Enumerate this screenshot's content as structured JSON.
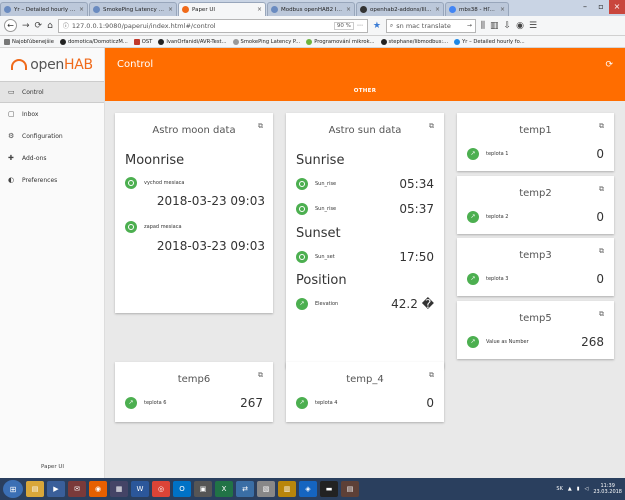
{
  "browser": {
    "tabs": [
      {
        "label": "Yr – Detailed hourly fo...",
        "active": false
      },
      {
        "label": "SmokePing Latency P...",
        "active": false
      },
      {
        "label": "Paper UI",
        "active": true
      },
      {
        "label": "Modbus openHAB2 In...",
        "active": false
      },
      {
        "label": "openhab2-addons/Ill...",
        "active": false
      },
      {
        "label": "mbs38 - Hľadať Googl...",
        "active": false
      }
    ],
    "url": "127.0.0.1:9080/paperui/index.html#/control",
    "zoom": "90 %",
    "search_placeholder": "sn mac translate",
    "bookmarks": [
      "Najobľúbenejšie",
      "domotica/DomoticzM...",
      "OST",
      "IvanOrfanidi/AVR-Test...",
      "SmokePing Latency P...",
      "Programování mikrok...",
      "stephane/libmodbus:...",
      "Yr – Detailed hourly fo..."
    ]
  },
  "app": {
    "logo_prefix": "open",
    "logo_suffix": "HAB",
    "header_title": "Control",
    "tab_label": "OTHER",
    "footer": "Paper UI",
    "nav": [
      {
        "label": "Control",
        "icon": "monitor-icon",
        "glyph": "▭",
        "active": true
      },
      {
        "label": "Inbox",
        "icon": "inbox-icon",
        "glyph": "▢",
        "active": false
      },
      {
        "label": "Configuration",
        "icon": "gear-icon",
        "glyph": "⚙",
        "active": false
      },
      {
        "label": "Add-ons",
        "icon": "puzzle-icon",
        "glyph": "✚",
        "active": false
      },
      {
        "label": "Preferences",
        "icon": "preferences-icon",
        "glyph": "◐",
        "active": false
      }
    ]
  },
  "cards": {
    "moon": {
      "title": "Astro moon data",
      "section": "Moonrise",
      "rows": [
        {
          "label": "vychod mesiaca",
          "value": "2018-03-23 09:03"
        },
        {
          "label": "zapad mesiaca",
          "value": "2018-03-23 09:03"
        }
      ]
    },
    "sun": {
      "title": "Astro sun data",
      "section_sunrise": "Sunrise",
      "section_sunset": "Sunset",
      "section_position": "Position",
      "rows": [
        {
          "label": "Sun_rise",
          "value": "05:34"
        },
        {
          "label": "Sun_rise",
          "value": "05:37"
        },
        {
          "label": "Sun_set",
          "value": "17:50"
        },
        {
          "label": "Elevation",
          "value": "42.2 �"
        }
      ]
    },
    "temp1": {
      "title": "temp1",
      "label": "teplota 1",
      "value": "0"
    },
    "temp2": {
      "title": "temp2",
      "label": "teplota 2",
      "value": "0"
    },
    "temp3": {
      "title": "temp3",
      "label": "teplota 3",
      "value": "0"
    },
    "temp5": {
      "title": "temp5",
      "label": "Value as Number",
      "value": "268"
    },
    "temp6": {
      "title": "temp6",
      "label": "teplota 6",
      "value": "267"
    },
    "temp4": {
      "title": "temp_4",
      "label": "teplota 4",
      "value": "0"
    }
  },
  "taskbar": {
    "lang": "SK",
    "time": "11:39",
    "date": "23.03.2018"
  },
  "colors": {
    "accent": "#ff6d00",
    "item_icon": "#4caf50"
  }
}
